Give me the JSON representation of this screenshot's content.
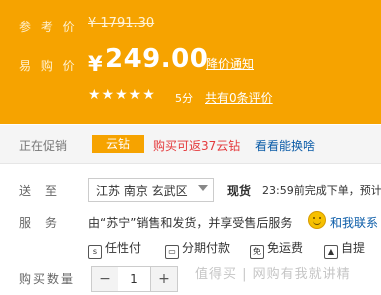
{
  "price": {
    "ref_label": "参 考 价",
    "original": "¥ 1791.30",
    "sale_label": "易 购 价",
    "currency": "¥",
    "sale": "249.00",
    "notify": "降价通知",
    "stars": "★★★★★",
    "score": "5分",
    "reviews": "共有0条评价"
  },
  "promo": {
    "label": "正在促销",
    "tag": "云钻",
    "text": "购买可返37云钻",
    "link": "看看能换啥"
  },
  "delivery": {
    "label": "送至",
    "address": "江苏 南京 玄武区",
    "stock": "现货",
    "text": "23:59前完成下单，预计"
  },
  "service": {
    "label": "服务",
    "text": "由“苏宁”销售和发货，并享受售后服务",
    "contact": "和我联系",
    "badges": [
      "任性付",
      "分期付款",
      "免运费",
      "自提"
    ],
    "badge_icons": [
      "s",
      "▭",
      "免",
      "▲"
    ]
  },
  "quantity": {
    "label": "购买数量",
    "minus": "−",
    "value": "1",
    "plus": "+"
  },
  "watermark": "值得买 | 网购有我就讲精"
}
